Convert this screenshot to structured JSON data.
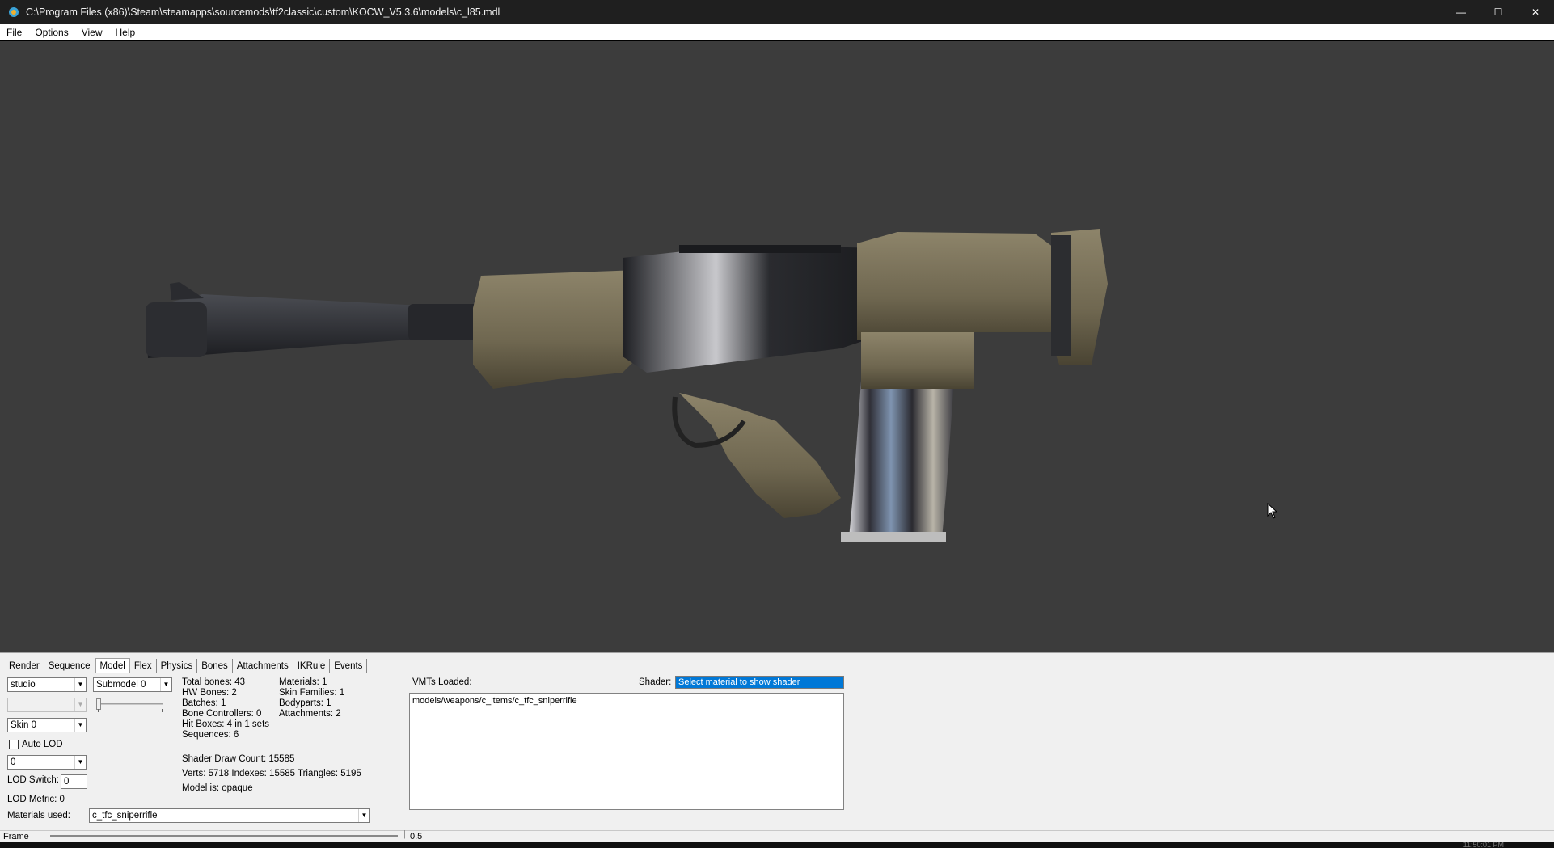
{
  "window": {
    "title": "C:\\Program Files (x86)\\Steam\\steamapps\\sourcemods\\tf2classic\\custom\\KOCW_V5.3.6\\models\\c_l85.mdl",
    "minimize_glyph": "—",
    "maximize_glyph": "☐",
    "close_glyph": "✕"
  },
  "menu": [
    "File",
    "Options",
    "View",
    "Help"
  ],
  "tabs": [
    "Render",
    "Sequence",
    "Model",
    "Flex",
    "Physics",
    "Bones",
    "Attachments",
    "IKRule",
    "Events"
  ],
  "active_tab": "Model",
  "model_panel": {
    "render_mode": "studio",
    "submodel": "Submodel 0",
    "skin": "Skin 0",
    "auto_lod_label": "Auto LOD",
    "lod_value": "0",
    "lod_switch_label": "LOD Switch:",
    "lod_switch_value": "0",
    "lod_metric": "LOD Metric:   0",
    "materials_used_label": "Materials used:",
    "materials_used_value": "c_tfc_sniperrifle"
  },
  "stats_col1": [
    "Total bones: 43",
    "HW Bones: 2",
    "Batches: 1",
    "Bone Controllers: 0",
    "Hit Boxes: 4 in 1 sets",
    "Sequences: 6"
  ],
  "stats_col2": [
    "Materials: 1",
    "Skin Families: 1",
    "Bodyparts: 1",
    "Attachments: 2"
  ],
  "shader_stats": [
    "Shader Draw Count: 15585",
    "Verts: 5718  Indexes: 15585  Triangles: 5195",
    "Model is: opaque"
  ],
  "vmt": {
    "label": "VMTs Loaded:",
    "shader_label": "Shader:",
    "shader_value": "Select material to show shader",
    "items": [
      "models/weapons/c_items/c_tfc_sniperrifle"
    ]
  },
  "status": {
    "frame_label": "Frame",
    "frame_value": "0.5",
    "clock": "11:50:01 PM"
  }
}
